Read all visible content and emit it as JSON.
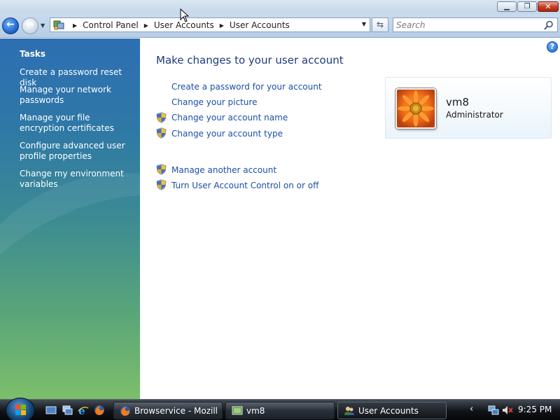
{
  "window": {
    "controls": {
      "minimize_icon": "minimize-icon",
      "maximize_icon": "maximize-icon",
      "close_icon": "close-icon"
    }
  },
  "navigation": {
    "breadcrumbs": [
      "Control Panel",
      "User Accounts",
      "User Accounts"
    ],
    "search_placeholder": "Search"
  },
  "sidebar": {
    "title": "Tasks",
    "links": [
      "Create a password reset disk",
      "Manage your network passwords",
      "Manage your file encryption certificates",
      "Configure advanced user profile properties",
      "Change my environment variables"
    ]
  },
  "main": {
    "title": "Make changes to your user account",
    "actions": [
      {
        "label": "Create a password for your account",
        "shield": false
      },
      {
        "label": "Change your picture",
        "shield": false
      },
      {
        "label": "Change your account name",
        "shield": true
      },
      {
        "label": "Change your account type",
        "shield": true
      }
    ],
    "other_actions": [
      {
        "label": "Manage another account",
        "shield": true
      },
      {
        "label": "Turn User Account Control on or off",
        "shield": true
      }
    ],
    "account": {
      "name": "vm8",
      "role": "Administrator"
    }
  },
  "taskbar": {
    "buttons": [
      {
        "label": "Browservice - Mozill...",
        "icon": "firefox-icon",
        "active": false
      },
      {
        "label": "vm8",
        "icon": "vm-icon",
        "active": false
      },
      {
        "label": "User Accounts",
        "icon": "user-accounts-icon",
        "active": true
      }
    ],
    "clock": "9:25 PM"
  },
  "colors": {
    "link": "#1a4fa8",
    "title": "#1d3b7a",
    "sidebar_top": "#2d6fb3",
    "sidebar_bottom": "#7cbf6a"
  }
}
